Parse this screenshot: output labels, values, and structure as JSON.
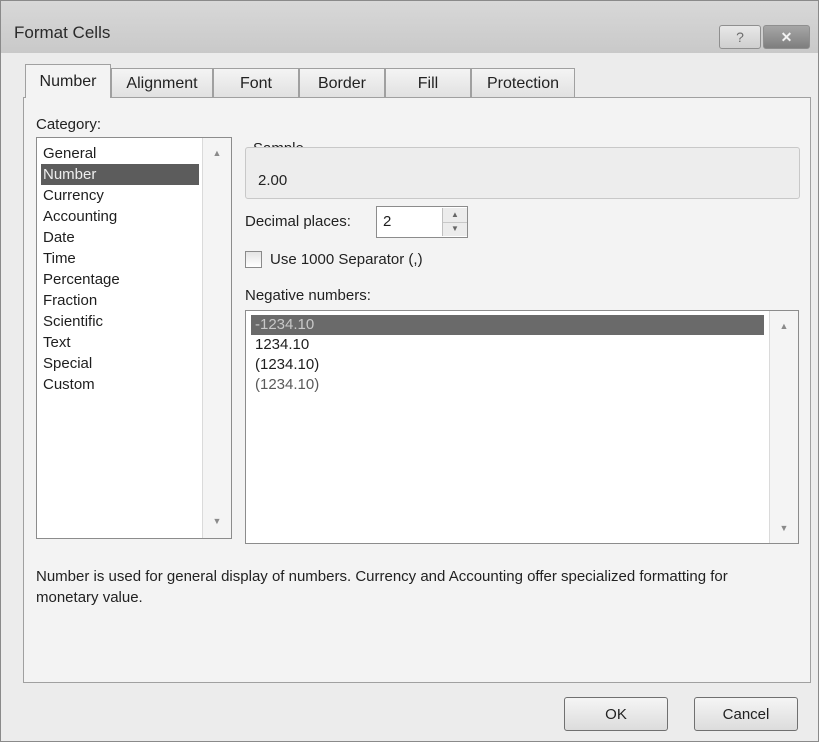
{
  "window": {
    "title": "Format Cells",
    "help_glyph": "?",
    "close_glyph": "✕"
  },
  "tabs": [
    {
      "label": "Number",
      "active": true
    },
    {
      "label": "Alignment",
      "active": false
    },
    {
      "label": "Font",
      "active": false
    },
    {
      "label": "Border",
      "active": false
    },
    {
      "label": "Fill",
      "active": false
    },
    {
      "label": "Protection",
      "active": false
    }
  ],
  "category": {
    "label": "Category:",
    "items": [
      "General",
      "Number",
      "Currency",
      "Accounting",
      "Date",
      "Time",
      "Percentage",
      "Fraction",
      "Scientific",
      "Text",
      "Special",
      "Custom"
    ],
    "selected": "Number"
  },
  "sample": {
    "label": "Sample",
    "value": "2.00"
  },
  "decimal_places": {
    "label": "Decimal places:",
    "value": "2"
  },
  "separator": {
    "label": "Use 1000 Separator (,)",
    "checked": false
  },
  "negative_numbers": {
    "label": "Negative numbers:",
    "items": [
      "-1234.10",
      "1234.10",
      "(1234.10)",
      "(1234.10)"
    ],
    "selected_index": 0
  },
  "description": "Number is used for general display of numbers.  Currency and Accounting offer specialized formatting for monetary value.",
  "buttons": {
    "ok": "OK",
    "cancel": "Cancel"
  },
  "colors": {
    "selection": "#5c5c5c",
    "dialog_bg": "#ececec"
  }
}
